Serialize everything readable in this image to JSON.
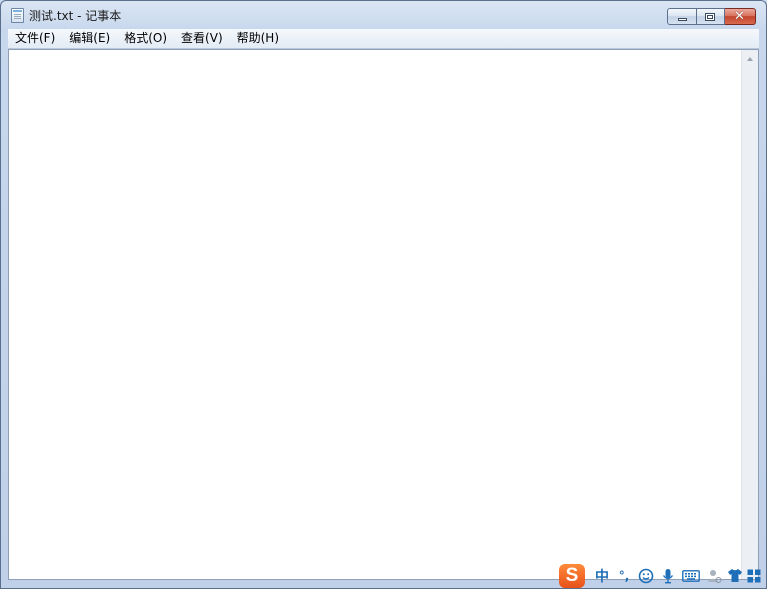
{
  "window": {
    "title": "测试.txt - 记事本"
  },
  "caption": {
    "minimize_symbol": "",
    "maximize_symbol": "",
    "close_symbol": "✕"
  },
  "menu": {
    "items": [
      {
        "label": "文件(F)"
      },
      {
        "label": "编辑(E)"
      },
      {
        "label": "格式(O)"
      },
      {
        "label": "查看(V)"
      },
      {
        "label": "帮助(H)"
      }
    ]
  },
  "editor": {
    "content": ""
  },
  "ime": {
    "logo": "S",
    "mode": "中",
    "punctuation": "°,",
    "icons": [
      "smiley-icon",
      "microphone-icon",
      "keyboard-icon",
      "user-icon",
      "shirt-icon",
      "grid-icon"
    ],
    "accent": "#1f6fb8",
    "logo_color": "#f06a25"
  }
}
